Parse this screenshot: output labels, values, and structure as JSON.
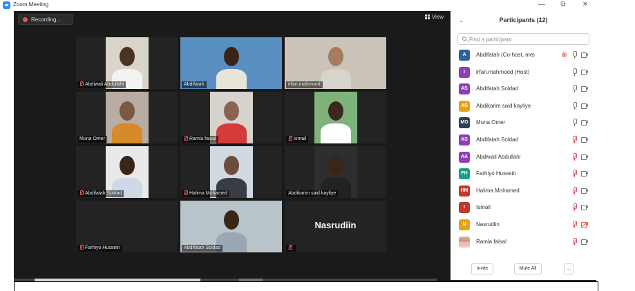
{
  "window": {
    "title": "Zoom Meeting",
    "minimize": "—",
    "restore": "⧉",
    "close": "✕"
  },
  "toolbar": {
    "recording_label": "Recording...",
    "view_label": "View"
  },
  "tiles": [
    {
      "name": "Abdiwali Abdullahi",
      "muted": true,
      "active": false,
      "bg": "#d9d5c8",
      "skin": "#4a3325",
      "shirt": "#f2f2f2"
    },
    {
      "name": "Abdifatah",
      "muted": false,
      "active": false,
      "bg": "#5a8fc2",
      "skin": "#3a2418",
      "shirt": "#e8e4d8"
    },
    {
      "name": "irfan.mahmood",
      "muted": false,
      "active": true,
      "bg": "#c9c3b9",
      "skin": "#a77c5e",
      "shirt": "#d8d3cb"
    },
    {
      "name": "Muna Omer",
      "muted": false,
      "active": false,
      "bg": "#b9aca3",
      "skin": "#7b5846",
      "shirt": "#d68a2a"
    },
    {
      "name": "Ramla faisal",
      "muted": true,
      "active": false,
      "bg": "#d7d2cc",
      "skin": "#8a6450",
      "shirt": "#d53b3b"
    },
    {
      "name": "Ismail",
      "muted": true,
      "active": false,
      "bg": "#7fb27a",
      "skin": "#3d281c",
      "shirt": "#ffffff"
    },
    {
      "name": "Abdifatah Soldad",
      "muted": true,
      "active": false,
      "bg": "#e9e9e9",
      "skin": "#3a2519",
      "shirt": "#cfd8e6"
    },
    {
      "name": "Halima Mohamed",
      "muted": true,
      "active": false,
      "bg": "#cfd9e2",
      "skin": "#6e4c3b",
      "shirt": "#3b3b46"
    },
    {
      "name": "Abdikarim said kayliye",
      "muted": false,
      "active": false,
      "bg": "#2e2e2e",
      "skin": "#3a2519",
      "shirt": "#222222"
    },
    {
      "name": "Farhiyo Hussein",
      "muted": true,
      "active": false,
      "bg": "",
      "skin": "",
      "shirt": ""
    },
    {
      "name": "Abdifatah Soldad",
      "muted": false,
      "active": false,
      "bg": "#b8c4c9",
      "skin": "#3a2519",
      "shirt": "#9aa7b4"
    },
    {
      "name": "",
      "muted": true,
      "active": false,
      "bg": "",
      "skin": "",
      "shirt": "",
      "big_name": "Nasrudiin"
    }
  ],
  "panel": {
    "title": "Participants (12)",
    "search_placeholder": "Find a participant",
    "participants": [
      {
        "initials": "A",
        "color": "#2b5f9e",
        "name": "Abdifatah (Co-host, me)",
        "recording": true,
        "mic_muted": false,
        "video_off": false
      },
      {
        "initials": "I",
        "color": "#8e3fb5",
        "name": "irfan.mahmood (Host)",
        "recording": false,
        "mic_muted": false,
        "video_off": false
      },
      {
        "initials": "AS",
        "color": "#8e3fb5",
        "name": "Abdifatah Soldad",
        "recording": false,
        "mic_muted": false,
        "video_off": false
      },
      {
        "initials": "AS",
        "color": "#e6a317",
        "name": "Abdikarim said kayliye",
        "recording": false,
        "mic_muted": false,
        "video_off": false
      },
      {
        "initials": "MO",
        "color": "#2f3e55",
        "name": "Muna Omer",
        "recording": false,
        "mic_muted": false,
        "video_off": false
      },
      {
        "initials": "AS",
        "color": "#8e3fb5",
        "name": "Abdifatah Soldad",
        "recording": false,
        "mic_muted": true,
        "video_off": false
      },
      {
        "initials": "AA",
        "color": "#8e3fb5",
        "name": "Abdiwali Abdullahi",
        "recording": false,
        "mic_muted": true,
        "video_off": false
      },
      {
        "initials": "FH",
        "color": "#17a085",
        "name": "Farhiyo Hussein",
        "recording": false,
        "mic_muted": true,
        "video_off": false
      },
      {
        "initials": "HM",
        "color": "#c0392b",
        "name": "Halima Mohamed",
        "recording": false,
        "mic_muted": true,
        "video_off": false
      },
      {
        "initials": "I",
        "color": "#c0392b",
        "name": "Ismail",
        "recording": false,
        "mic_muted": true,
        "video_off": false
      },
      {
        "initials": "N",
        "color": "#e6a317",
        "name": "Nasrudiin",
        "recording": false,
        "mic_muted": true,
        "video_off": true
      },
      {
        "initials": "",
        "color": "",
        "name": "Ramla faisal",
        "recording": false,
        "mic_muted": true,
        "video_off": false,
        "photo": true
      }
    ],
    "footer": {
      "invite": "Invite",
      "mute_all": "Mute All",
      "more": "..."
    }
  }
}
